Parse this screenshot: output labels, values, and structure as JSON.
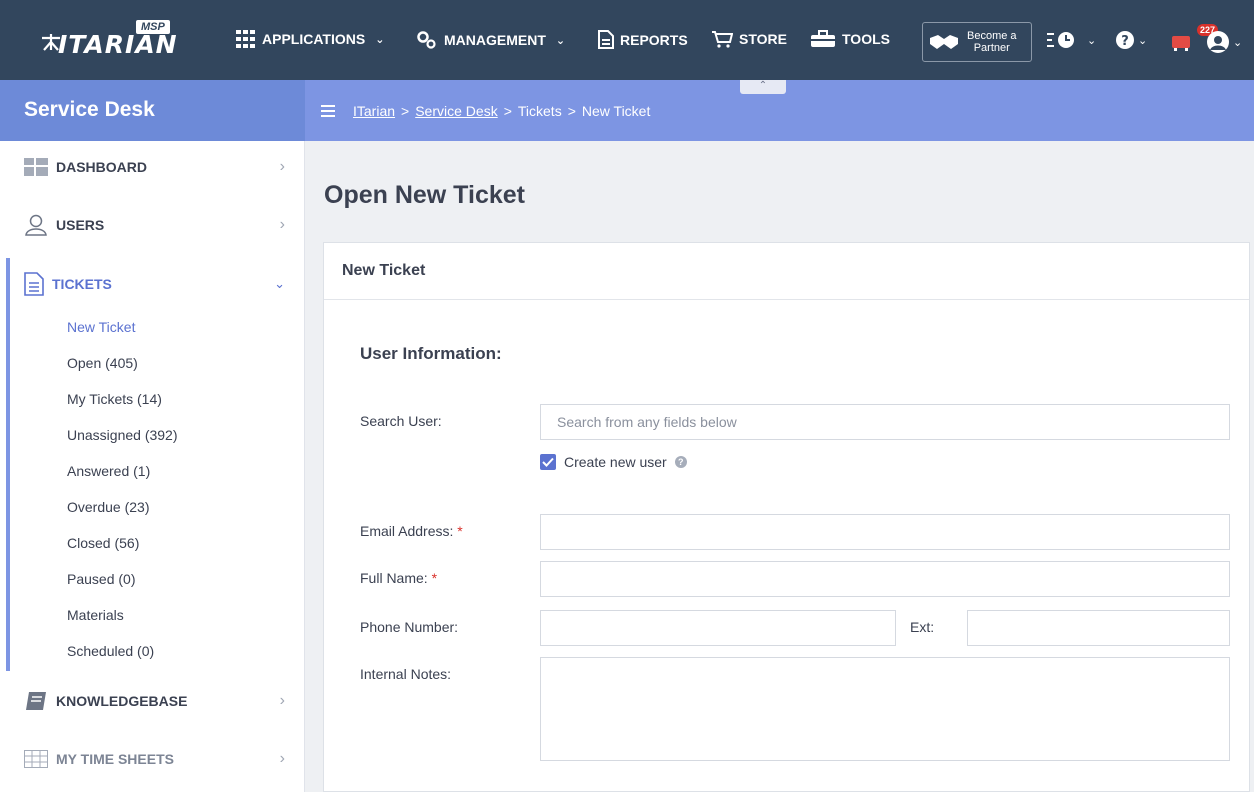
{
  "brand": {
    "logo_text": "ITARIAN",
    "logo_badge": "MSP"
  },
  "topnav": {
    "applications": "APPLICATIONS",
    "management": "MANAGEMENT",
    "reports": "REPORTS",
    "store": "STORE",
    "tools": "TOOLS",
    "partner_line1": "Become a",
    "partner_line2": "Partner",
    "notification_count": "227"
  },
  "module_title": "Service Desk",
  "breadcrumb": {
    "root": "ITarian",
    "sep": ">",
    "service_desk": "Service Desk",
    "tickets": "Tickets",
    "current": "New Ticket"
  },
  "sidebar": {
    "dashboard": "DASHBOARD",
    "users": "USERS",
    "tickets": "TICKETS",
    "knowledgebase": "KNOWLEDGEBASE",
    "time_sheets": "MY TIME SHEETS",
    "ticket_items": [
      "New Ticket",
      "Open (405)",
      "My Tickets (14)",
      "Unassigned (392)",
      "Answered (1)",
      "Overdue (23)",
      "Closed (56)",
      "Paused (0)",
      "Materials",
      "Scheduled (0)"
    ]
  },
  "page": {
    "title": "Open New Ticket",
    "card_title": "New Ticket",
    "section_title": "User Information:",
    "search_label": "Search User:",
    "search_placeholder": "Search from any fields below",
    "create_user_label": "Create new user",
    "email_label": "Email Address:",
    "fullname_label": "Full Name:",
    "phone_label": "Phone Number:",
    "ext_label": "Ext:",
    "notes_label": "Internal Notes:",
    "required_mark": "*"
  },
  "colors": {
    "topbar": "#32465d",
    "accent": "#7d95e3",
    "active_text": "#5b72d0"
  }
}
